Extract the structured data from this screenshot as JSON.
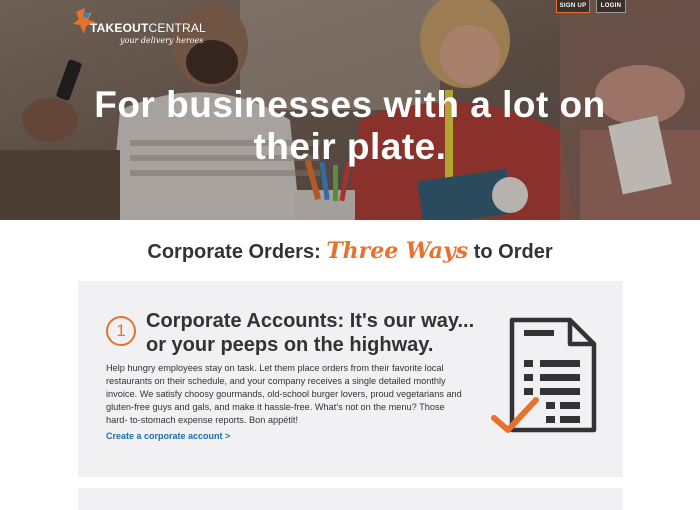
{
  "header": {
    "logo": {
      "brand_part1": "TAKEOUT",
      "brand_part2": "CENTRAL",
      "tagline": "your delivery heroes",
      "icon": "takeout-hero-icon"
    },
    "signup_label": "SIGN UP",
    "login_label": "LOGIN"
  },
  "hero": {
    "title": "For businesses with a lot on their plate."
  },
  "section": {
    "heading_before": "Corporate Orders: ",
    "heading_accent": "Three Ways",
    "heading_after": " to Order"
  },
  "cards": [
    {
      "number": "1",
      "title": "Corporate Accounts: It's our way... or your peeps on the highway.",
      "body": "Help hungry employees stay on task. Let them place orders from their favorite local restaurants on their schedule, and your company receives a single detailed monthly invoice. We satisfy choosy gourmands, old-school burger lovers, proud vegetarians and gluten-free guys and gals, and make it hassle-free. What's not on the menu? Those hard- to-stomach expense reports. Bon appétit!",
      "link": "Create a corporate account >",
      "icon": "invoice-checkmark-icon"
    }
  ],
  "colors": {
    "accent": "#e8712e",
    "link": "#1a6fa8",
    "card_bg": "#f1f1f3",
    "text": "#333333"
  }
}
